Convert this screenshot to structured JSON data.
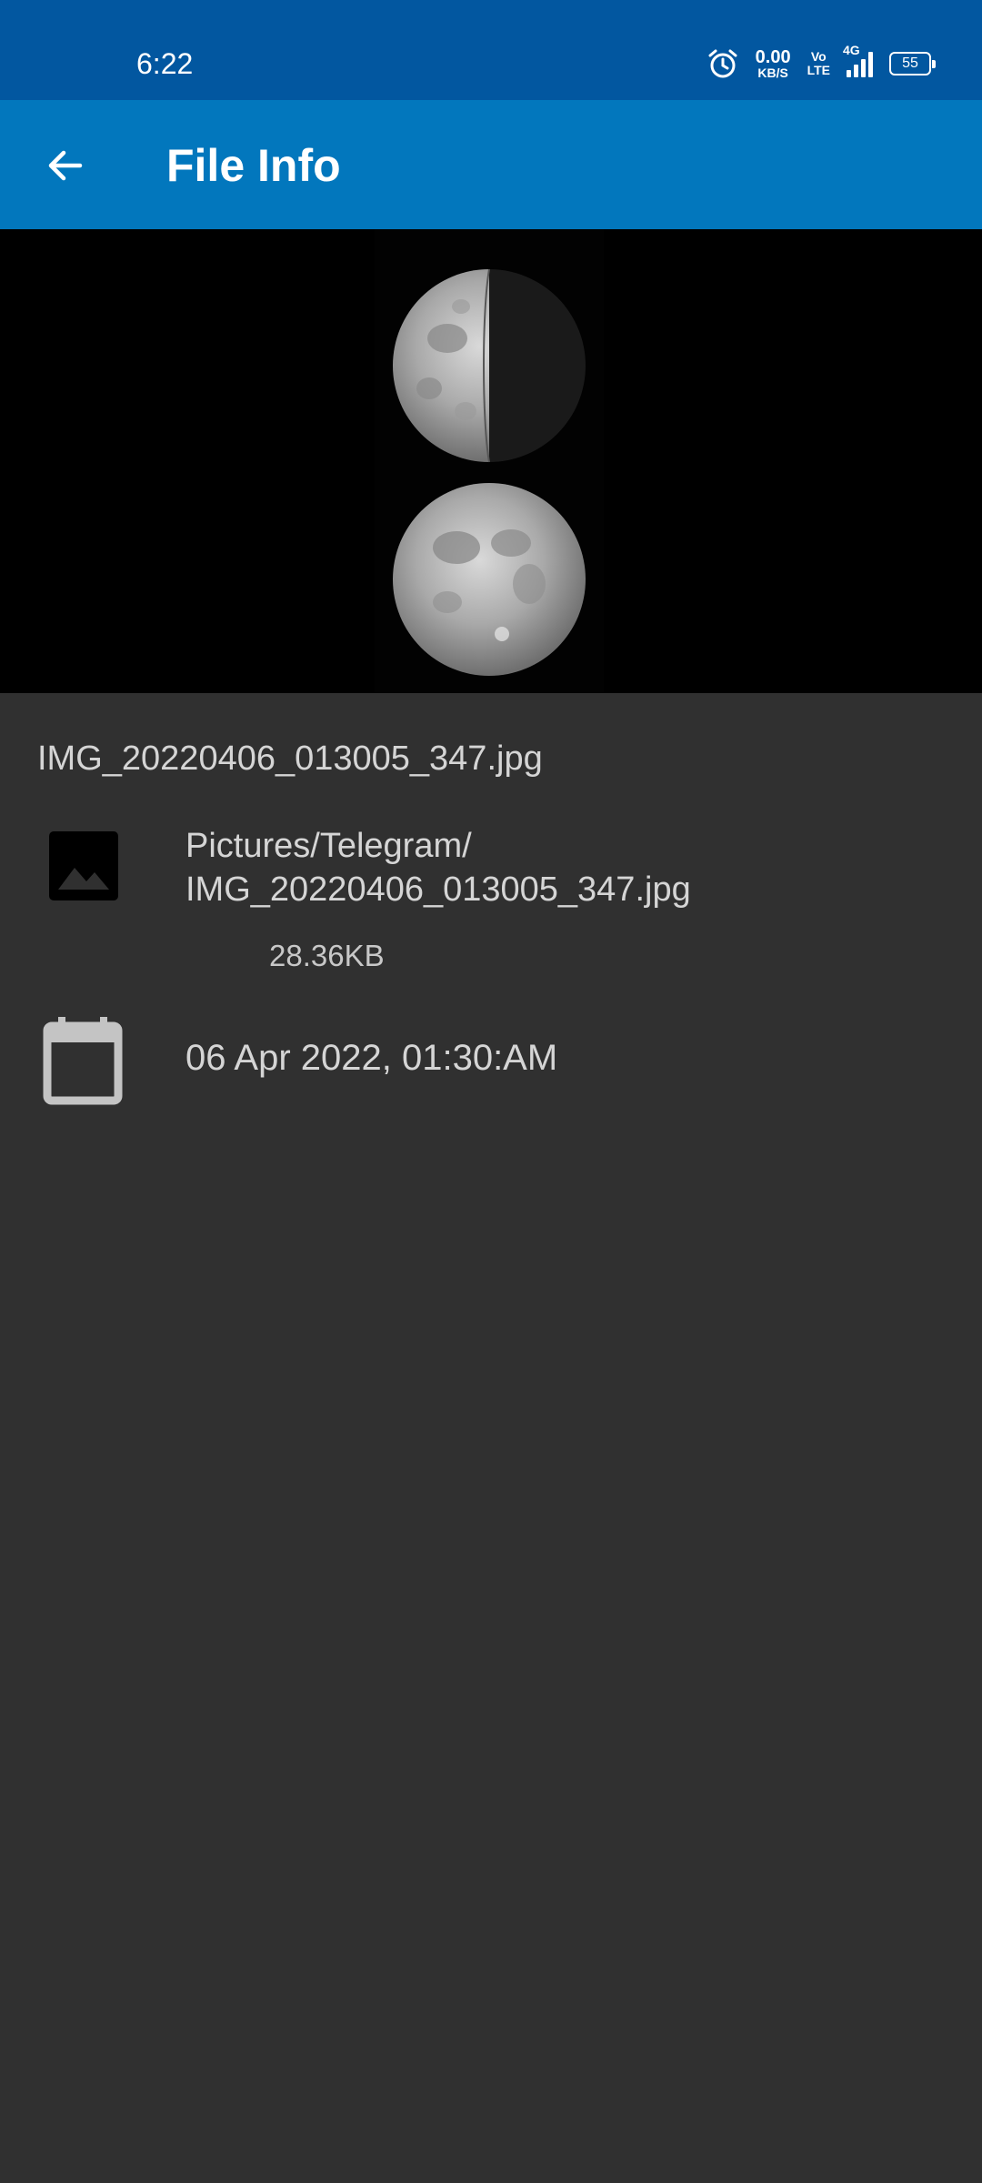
{
  "status_bar": {
    "time": "6:22",
    "speed_value": "0.00",
    "speed_unit": "KB/S",
    "volte_top": "Vo",
    "volte_bottom": "LTE",
    "network": "4G",
    "battery": "55",
    "icons": [
      "alarm-icon",
      "signal-icon",
      "battery-icon"
    ]
  },
  "app_bar": {
    "title": "File Info",
    "back_icon": "arrow-back-icon",
    "background": "#0277bd"
  },
  "preview": {
    "description_icon": "moon-phases-image"
  },
  "file": {
    "name": "IMG_20220406_013005_347.jpg",
    "path_line1": "Pictures/Telegram/",
    "path_line2": "IMG_20220406_013005_347.jpg",
    "size": "28.36KB",
    "date": "06 Apr 2022, 01:30:AM",
    "path_icon": "image-icon",
    "date_icon": "calendar-icon"
  },
  "colors": {
    "status_bar": "#0257a0",
    "app_bar": "#0277bd",
    "background": "#303030",
    "text": "#d5d5d5"
  }
}
